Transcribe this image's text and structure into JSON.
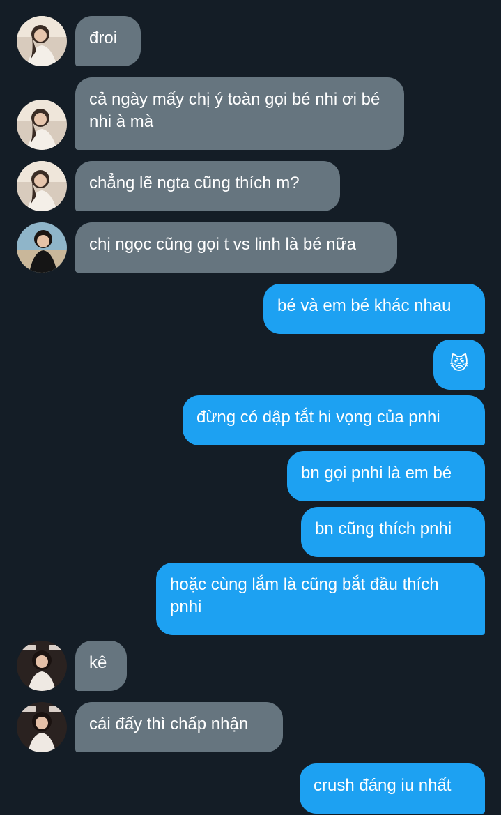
{
  "messages": [
    {
      "text": "đroi",
      "dir": "in",
      "avatar": "a"
    },
    {
      "text": "cả ngày mấy chị ý toàn gọi bé nhi ơi bé nhi à mà",
      "dir": "in",
      "avatar": "a"
    },
    {
      "text": "chẳng lẽ ngta cũng thích m?",
      "dir": "in",
      "avatar": "a"
    },
    {
      "text": "chị ngọc cũng gọi t vs linh là bé nữa",
      "dir": "in",
      "avatar": "b"
    },
    {
      "text": "bé và em bé khác nhau",
      "dir": "out"
    },
    {
      "text": "😾",
      "dir": "out"
    },
    {
      "text": "đừng có dập tắt hi vọng của pnhi",
      "dir": "out"
    },
    {
      "text": "bn gọi pnhi là em bé",
      "dir": "out"
    },
    {
      "text": "bn cũng thích pnhi",
      "dir": "out"
    },
    {
      "text": "hoặc cùng lắm là cũng bắt đầu thích pnhi",
      "dir": "out"
    },
    {
      "text": "kê",
      "dir": "in",
      "avatar": "c"
    },
    {
      "text": "cái đấy thì chấp nhận",
      "dir": "in",
      "avatar": "c"
    },
    {
      "text": "crush đáng iu nhất",
      "dir": "out"
    }
  ],
  "colors": {
    "background": "#141d26",
    "incoming_bubble": "#66757f",
    "outgoing_bubble": "#1da1f2",
    "text": "#ffffff"
  }
}
